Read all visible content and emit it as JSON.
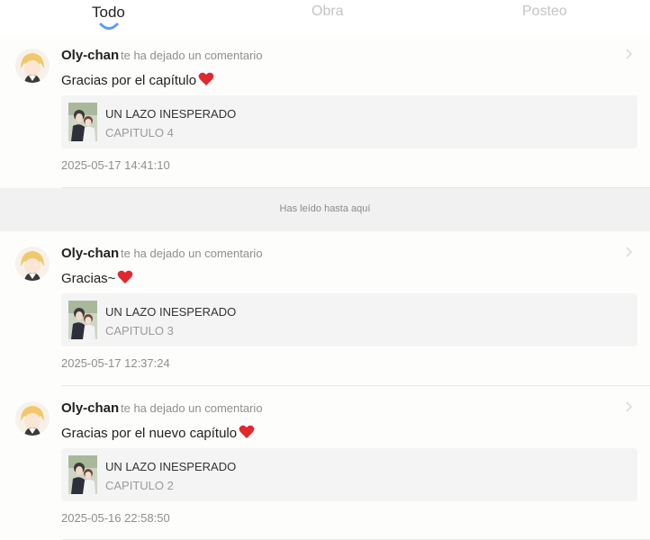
{
  "tabs": [
    {
      "label": "Todo",
      "active": true
    },
    {
      "label": "Obra",
      "active": false
    },
    {
      "label": "Posteo",
      "active": false
    }
  ],
  "read_marker": "Has leído hasta aquí",
  "notifications": [
    {
      "username": "Oly-chan",
      "action": "te ha dejado un comentario",
      "message": "Gracias por el capítulo",
      "emoji": "red-heart",
      "work_title": "UN LAZO INESPERADO",
      "chapter": "CAPITULO 4",
      "timestamp": "2025-05-17 14:41:10"
    },
    {
      "username": "Oly-chan",
      "action": "te ha dejado un comentario",
      "message": "Gracias~",
      "emoji": "red-heart",
      "work_title": "UN LAZO INESPERADO",
      "chapter": "CAPITULO 3",
      "timestamp": "2025-05-17 12:37:24"
    },
    {
      "username": "Oly-chan",
      "action": "te ha dejado un comentario",
      "message": "Gracias por el nuevo capítulo",
      "emoji": "red-heart",
      "work_title": "UN LAZO INESPERADO",
      "chapter": "CAPITULO 2",
      "timestamp": "2025-05-16 22:58:50"
    }
  ],
  "colors": {
    "accent": "#5b9cf2",
    "heart": "#e0282e",
    "muted_text": "#8f8f8f"
  }
}
